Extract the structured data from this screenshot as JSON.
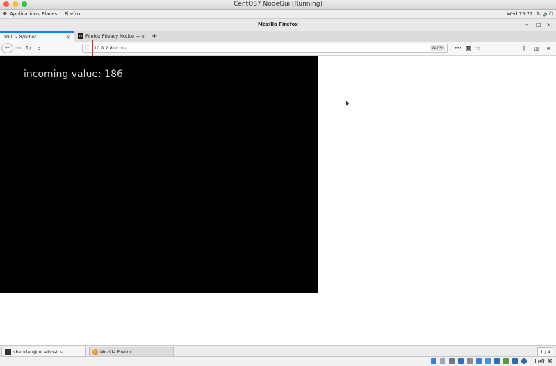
{
  "mac_window": {
    "title": "CentOS7 NodeGui [Running]"
  },
  "gnome_panel": {
    "applications": "Applications",
    "places": "Places",
    "firefox": "Firefox",
    "clock": "Wed 15:22"
  },
  "firefox_window": {
    "title": "Mozilla Firefox",
    "minimize": "–",
    "maximize": "□",
    "close": "×"
  },
  "tabs": [
    {
      "label": "10.0.2.8/echo/",
      "active": true
    },
    {
      "label": "Firefox Privacy Notice —",
      "active": false
    }
  ],
  "new_tab_label": "+",
  "navbar": {
    "url_host": "10.0.2.8",
    "url_path": "/echo/",
    "zoom": "240%",
    "more": "•••"
  },
  "page": {
    "incoming_text": "incoming value: 186"
  },
  "taskbar": {
    "items": [
      {
        "label": "sheridan@localhost:~",
        "icon": "terminal-icon"
      },
      {
        "label": "Mozilla Firefox",
        "icon": "firefox-icon"
      }
    ],
    "pager": "1 / 4"
  },
  "status_bar": {
    "host_key": "Left ⌘"
  },
  "colors": {
    "accent": "#0a84ff",
    "highlight": "#e2222a",
    "canvas_bg": "#000000",
    "canvas_text": "#d6d6d6"
  }
}
